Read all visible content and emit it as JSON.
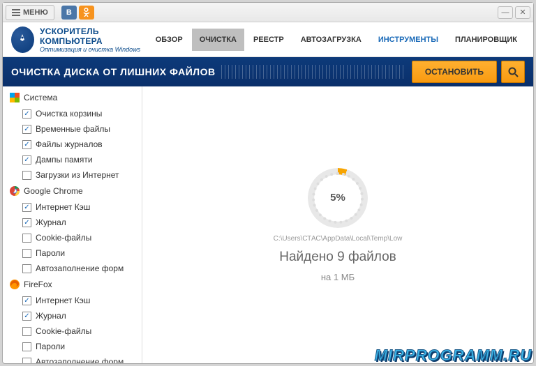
{
  "titlebar": {
    "menu": "МЕНЮ"
  },
  "logo": {
    "title": "УСКОРИТЕЛЬ КОМПЬЮТЕРА",
    "subtitle": "Оптимизация и очистка Windows"
  },
  "tabs": [
    {
      "label": "ОБЗОР",
      "active": false
    },
    {
      "label": "ОЧИСТКА",
      "active": true
    },
    {
      "label": "РЕЕСТР",
      "active": false
    },
    {
      "label": "АВТОЗАГРУЗКА",
      "active": false
    },
    {
      "label": "ИНСТРУМЕНТЫ",
      "active": false,
      "highlight": true
    },
    {
      "label": "ПЛАНИРОВЩИК",
      "active": false
    }
  ],
  "banner": {
    "title": "ОЧИСТКА ДИСКА ОТ ЛИШНИХ ФАЙЛОВ",
    "stop": "ОСТАНОВИТЬ"
  },
  "sidebar": {
    "groups": [
      {
        "name": "Система",
        "icon": "windows",
        "items": [
          {
            "label": "Очистка корзины",
            "checked": true
          },
          {
            "label": "Временные файлы",
            "checked": true
          },
          {
            "label": "Файлы журналов",
            "checked": true
          },
          {
            "label": "Дампы памяти",
            "checked": true
          },
          {
            "label": "Загрузки из Интернет",
            "checked": false
          }
        ]
      },
      {
        "name": "Google Chrome",
        "icon": "chrome",
        "items": [
          {
            "label": "Интернет Кэш",
            "checked": true
          },
          {
            "label": "Журнал",
            "checked": true
          },
          {
            "label": "Cookie-файлы",
            "checked": false
          },
          {
            "label": "Пароли",
            "checked": false
          },
          {
            "label": "Автозаполнение форм",
            "checked": false
          }
        ]
      },
      {
        "name": "FireFox",
        "icon": "firefox",
        "items": [
          {
            "label": "Интернет Кэш",
            "checked": true
          },
          {
            "label": "Журнал",
            "checked": true
          },
          {
            "label": "Cookie-файлы",
            "checked": false
          },
          {
            "label": "Пароли",
            "checked": false
          },
          {
            "label": "Автозаполнение форм",
            "checked": false
          }
        ]
      }
    ]
  },
  "progress": {
    "percent": "5%",
    "path": "C:\\Users\\СТАС\\AppData\\Local\\Temp\\Low",
    "found": "Найдено 9 файлов",
    "size": "на 1 МБ"
  },
  "watermark": "MIRPROGRAMM.RU"
}
